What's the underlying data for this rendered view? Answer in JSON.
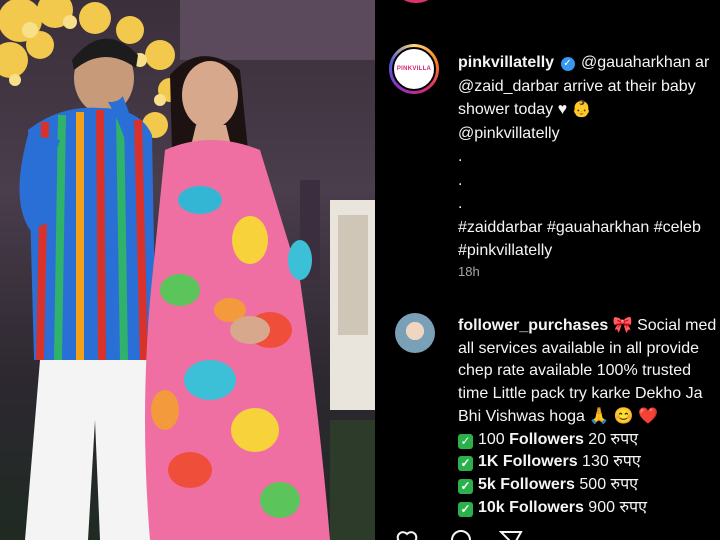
{
  "header": {
    "subtitle": ""
  },
  "post": {
    "username": "pinkvillatelly",
    "avatar_logo": "PINKVILLA",
    "caption_lines": [
      "@gauaharkhan ar",
      "@zaid_darbar arrive at their baby",
      "shower today ♥ 👶",
      "@pinkvillatelly",
      ".",
      ".",
      ".",
      "#zaiddarbar #gauaharkhan #celeb",
      "#pinkvillatelly"
    ],
    "timestamp": "18h"
  },
  "comment": {
    "username": "follower_purchases",
    "emoji_bow": "🎀",
    "lines": [
      "Social med",
      "all services available in all provide",
      "chep rate available 100% trusted",
      "time Little pack try karke Dekho Ja",
      "Bhi Vishwas hoga 🙏 😊 ❤️"
    ],
    "offers": [
      {
        "qty": "100",
        "label": "Followers",
        "price": "20 रुपए"
      },
      {
        "qty": "1K",
        "label": "Followers",
        "price": "130 रुपए"
      },
      {
        "qty": "5k",
        "label": "Followers",
        "price": "500 रुपए"
      },
      {
        "qty": "10k",
        "label": "Followers",
        "price": "900 रुपए"
      }
    ]
  },
  "icons": [
    "heart-icon",
    "comment-icon",
    "share-icon",
    "verified-icon",
    "check-icon"
  ],
  "colors": {
    "background": "#000000",
    "text": "#f5f5f5",
    "muted": "#a8a8a8",
    "verified": "#3897f0",
    "check": "#2bb14b"
  }
}
